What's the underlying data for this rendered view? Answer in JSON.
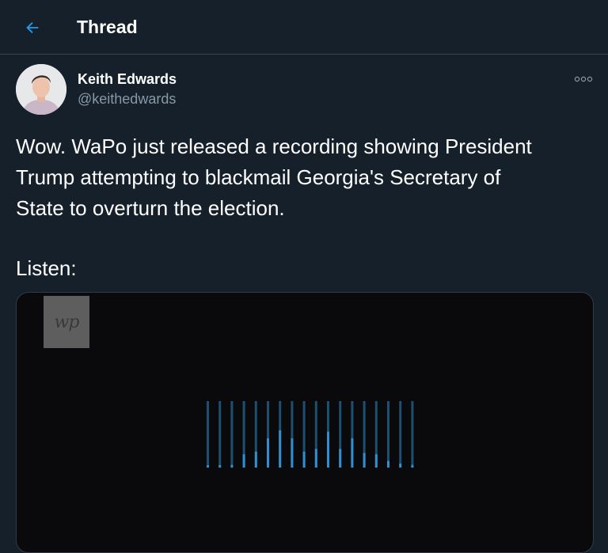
{
  "header": {
    "title": "Thread",
    "back_icon": "arrow-left-icon",
    "accent": "#1da1f2"
  },
  "tweet": {
    "author_name": "Keith Edwards",
    "author_handle": "@keithedwards",
    "text_lines": [
      "Wow. WaPo just released a recording showing President",
      "Trump attempting to blackmail Georgia's Secretary of",
      "State to overturn the election."
    ],
    "listen": "Listen:",
    "more_icon": "more-dots-icon"
  },
  "media": {
    "logo_text": "wp",
    "waveform_levels": [
      0,
      0,
      0.04,
      0.2,
      0.24,
      0.44,
      0.56,
      0.44,
      0.24,
      0.28,
      0.54,
      0.28,
      0.44,
      0.22,
      0.2,
      0.1,
      0.06,
      0.04
    ]
  },
  "colors": {
    "background": "#15202b",
    "border": "#38444d",
    "secondary_text": "#8899a6",
    "wave_active": "#2f8fd0",
    "wave_track": "#1d4f70"
  }
}
